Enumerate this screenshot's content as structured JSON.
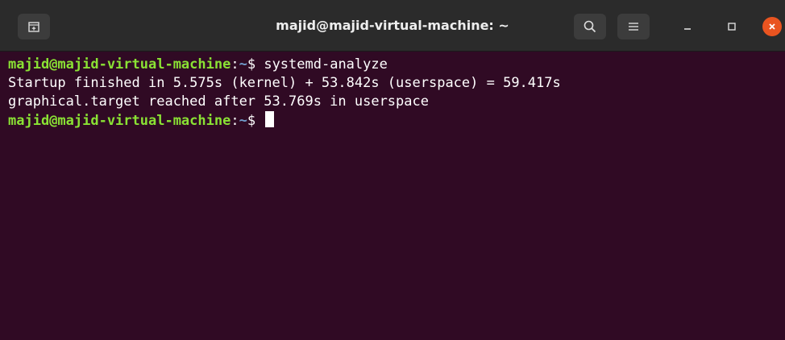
{
  "window": {
    "title": "majid@majid-virtual-machine: ~"
  },
  "titlebar": {
    "new_tab_icon": "new-tab-icon",
    "search_icon": "search-icon",
    "menu_icon": "hamburger-menu-icon",
    "minimize_icon": "minimize-icon",
    "maximize_icon": "maximize-icon",
    "close_icon": "close-icon"
  },
  "terminal": {
    "prompt1": {
      "user_host": "majid@majid-virtual-machine",
      "colon": ":",
      "cwd": "~",
      "symbol": "$ ",
      "command": "systemd-analyze"
    },
    "output": [
      "Startup finished in 5.575s (kernel) + 53.842s (userspace) = 59.417s",
      "graphical.target reached after 53.769s in userspace"
    ],
    "prompt2": {
      "user_host": "majid@majid-virtual-machine",
      "colon": ":",
      "cwd": "~",
      "symbol": "$ ",
      "command": ""
    }
  },
  "colors": {
    "background": "#300a24",
    "titlebar": "#2b2b2b",
    "user_host": "#8ae234",
    "cwd": "#729fcf",
    "close_button": "#e95420"
  }
}
